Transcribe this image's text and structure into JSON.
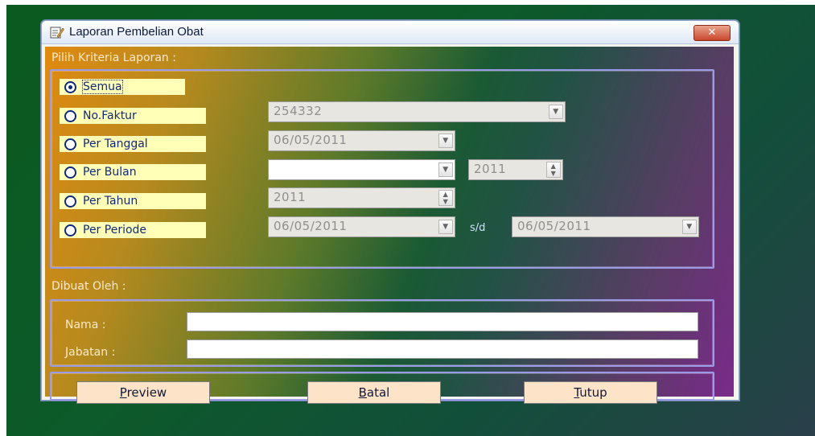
{
  "window": {
    "title": "Laporan Pembelian Obat",
    "close_glyph": "✕"
  },
  "criteria": {
    "section_label": "Pilih Kriteria Laporan :",
    "options": [
      {
        "label": "Semua",
        "checked": true
      },
      {
        "label": "No.Faktur",
        "checked": false
      },
      {
        "label": "Per Tanggal",
        "checked": false
      },
      {
        "label": "Per Bulan",
        "checked": false
      },
      {
        "label": "Per Tahun",
        "checked": false
      },
      {
        "label": "Per Periode",
        "checked": false
      }
    ],
    "no_faktur_value": "254332",
    "tanggal_value": "06/05/2011",
    "bulan_value": "",
    "bulan_year_value": "2011",
    "tahun_value": "2011",
    "periode_from_value": "06/05/2011",
    "periode_separator": "s/d",
    "periode_to_value": "06/05/2011"
  },
  "created_by": {
    "section_label": "Dibuat Oleh :",
    "nama_label": "Nama :",
    "nama_value": "",
    "jabatan_label": "Jabatan :",
    "jabatan_value": ""
  },
  "actions": {
    "preview_mnemonic": "P",
    "preview_rest": "review",
    "batal_mnemonic": "B",
    "batal_rest": "atal",
    "tutup_mnemonic": "T",
    "tutup_rest": "utup"
  },
  "icons": {
    "window_icon": "report-pencil-icon",
    "close": "close-icon",
    "dropdown": "chevron-down-icon",
    "spinner": "spinner-arrows-icon"
  },
  "colors": {
    "radio_bg": "#ffffb8",
    "button_bg": "#fde3c8",
    "group_border": "#9a9ae8",
    "label_text": "#ffe9c8"
  }
}
